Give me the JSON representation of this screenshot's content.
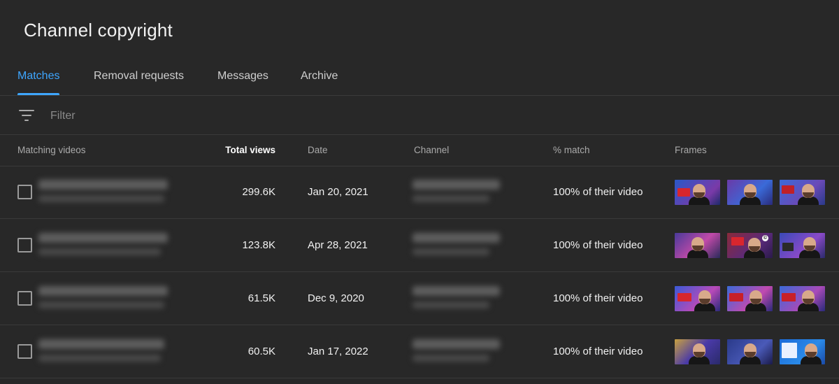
{
  "page": {
    "title": "Channel copyright"
  },
  "tabs": [
    {
      "label": "Matches",
      "active": true
    },
    {
      "label": "Removal requests",
      "active": false
    },
    {
      "label": "Messages",
      "active": false
    },
    {
      "label": "Archive",
      "active": false
    }
  ],
  "filter": {
    "placeholder": "Filter",
    "value": "",
    "icon": "filter-icon"
  },
  "table": {
    "columns": {
      "matching_videos": "Matching videos",
      "total_views": "Total views",
      "date": "Date",
      "channel": "Channel",
      "percent_match": "% match",
      "frames": "Frames"
    },
    "rows": [
      {
        "views": "299.6K",
        "date": "Jan 20, 2021",
        "match": "100% of their video",
        "checked": false
      },
      {
        "views": "123.8K",
        "date": "Apr 28, 2021",
        "match": "100% of their video",
        "checked": false
      },
      {
        "views": "61.5K",
        "date": "Dec 9, 2020",
        "match": "100% of their video",
        "checked": false
      },
      {
        "views": "60.5K",
        "date": "Jan 17, 2022",
        "match": "100% of their video",
        "checked": false
      }
    ]
  },
  "colors": {
    "background": "#282828",
    "accent": "#3ea6ff",
    "divider": "#3a3a3a",
    "text_primary": "#f1f1f1",
    "text_secondary": "#aaaaaa"
  }
}
